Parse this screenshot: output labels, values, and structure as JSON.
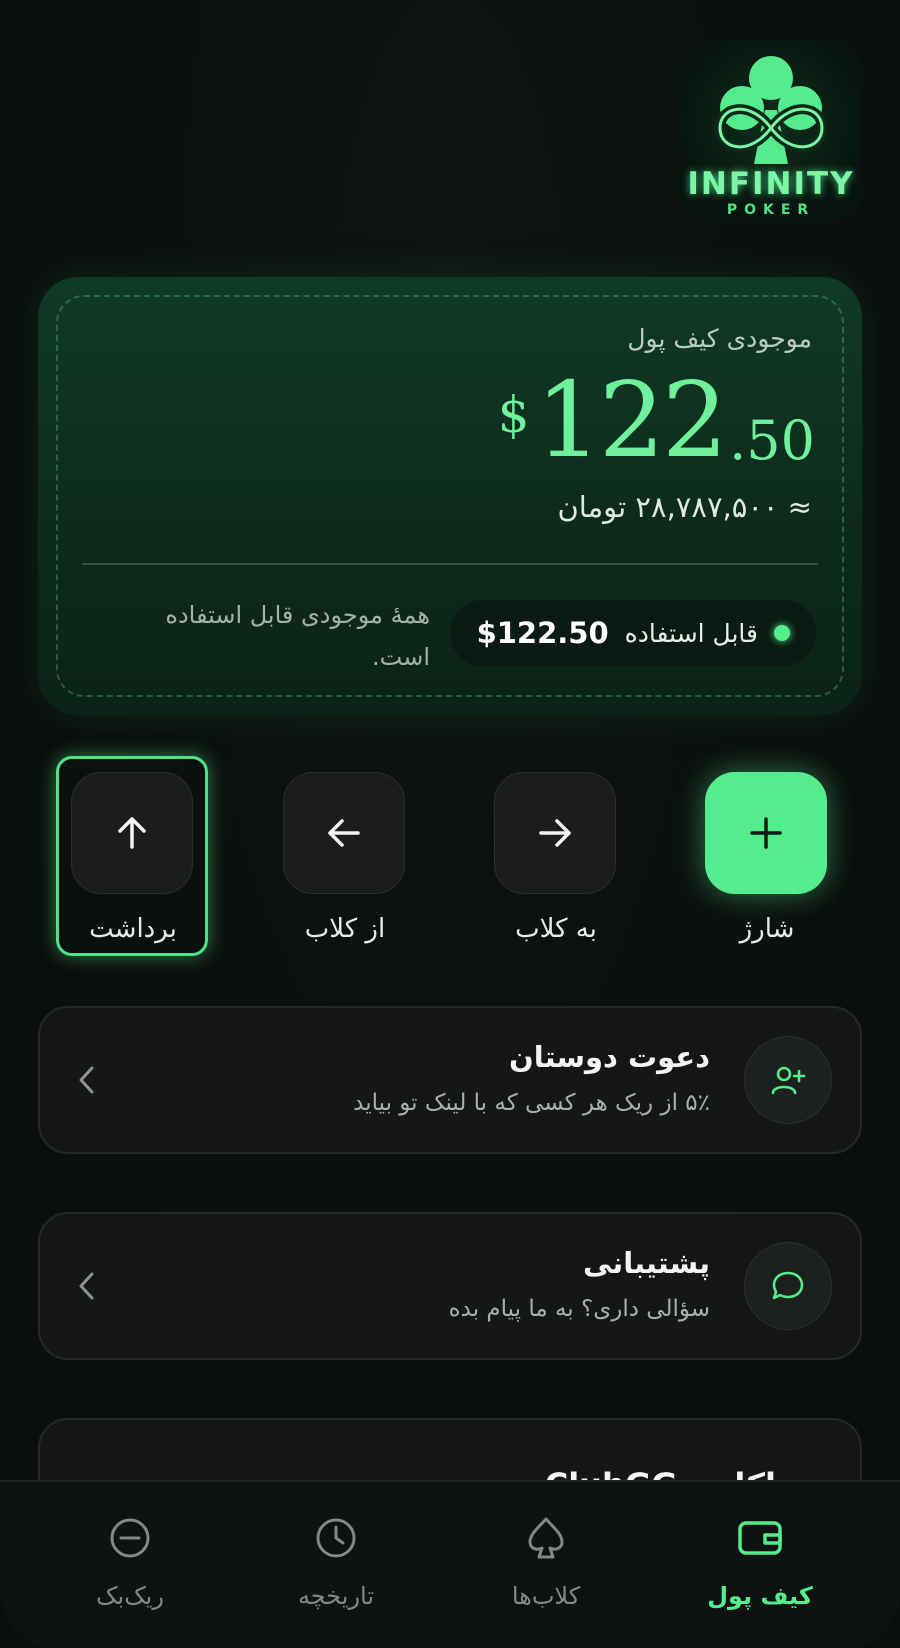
{
  "logo": {
    "title": "INFINITY",
    "subtitle": "POKER"
  },
  "balance": {
    "label": "موجودی کیف پول",
    "currency": "$",
    "integer": "122",
    "decimal": ".50",
    "toman": "≈ ۲۸,۷۸۷,۵۰۰ تومان",
    "available_label": "قابل استفاده",
    "available_value": "$122.50",
    "note": "همهٔ موجودی قابل استفاده است."
  },
  "actions": [
    {
      "label": "شارژ",
      "icon": "plus-icon"
    },
    {
      "label": "به کلاب",
      "icon": "arrow-right-icon"
    },
    {
      "label": "از کلاب",
      "icon": "arrow-left-icon"
    },
    {
      "label": "برداشت",
      "icon": "arrow-up-icon"
    }
  ],
  "links": [
    {
      "title": "دعوت دوستان",
      "subtitle": "۵٪ از ریک هر کسی که با لینک تو بیاید",
      "icon": "user-add-icon"
    },
    {
      "title": "پشتیبانی",
      "subtitle": "سؤالی داری؟ به ما پیام بده",
      "icon": "chat-bubble-icon"
    }
  ],
  "partial_card": {
    "title": "اکانت ClubGG"
  },
  "nav": [
    {
      "label": "کیف پول",
      "icon": "wallet-icon",
      "active": true
    },
    {
      "label": "کلاب‌ها",
      "icon": "spade-icon",
      "active": false
    },
    {
      "label": "تاریخچه",
      "icon": "clock-icon",
      "active": false
    },
    {
      "label": "ریک‌بک",
      "icon": "minus-circle-icon",
      "active": false
    }
  ],
  "colors": {
    "accent": "#55ec8d",
    "background": "#0b0f0d",
    "card": "#141715"
  }
}
